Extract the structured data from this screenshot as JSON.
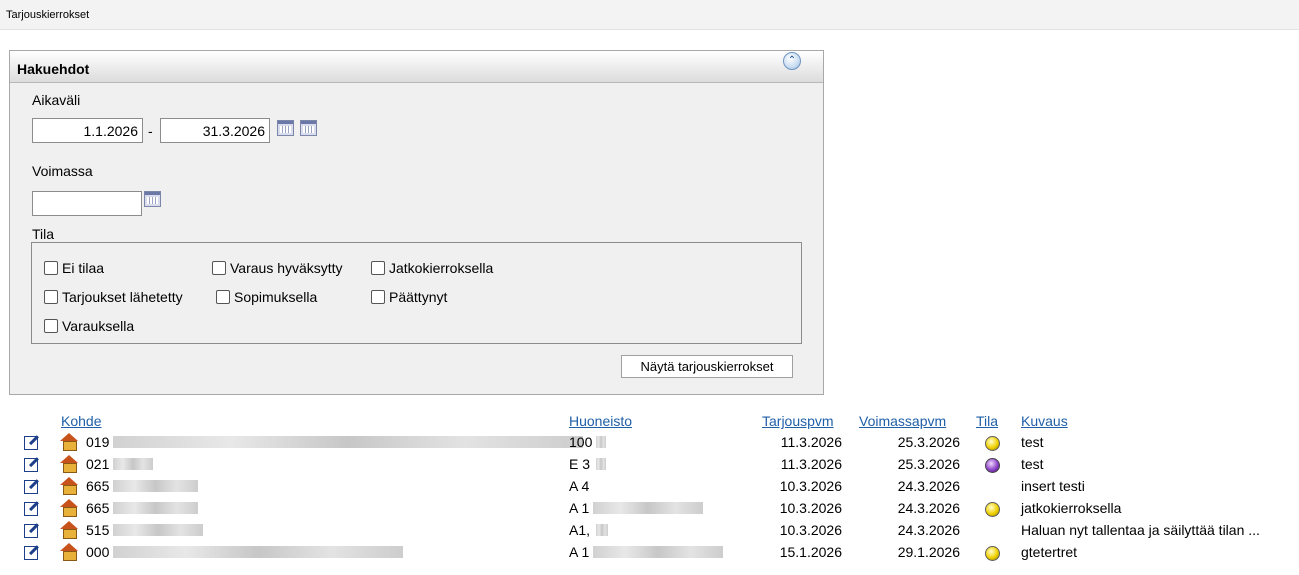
{
  "window": {
    "title": "Tarjouskierrokset"
  },
  "search": {
    "title": "Hakuehdot",
    "period_label": "Aikaväli",
    "date_from": "1.1.2026",
    "separator": "-",
    "date_to": "31.3.2026",
    "valid_label": "Voimassa",
    "valid_value": "",
    "status_label": "Tila",
    "checkboxes": [
      {
        "label": "Ei tilaa",
        "checked": false
      },
      {
        "label": "Varaus hyväksytty",
        "checked": false
      },
      {
        "label": "Jatkokierroksella",
        "checked": false
      },
      {
        "label": "Tarjoukset lähetetty",
        "checked": false
      },
      {
        "label": "Sopimuksella",
        "checked": false
      },
      {
        "label": "Päättynyt",
        "checked": false
      },
      {
        "label": "Varauksella",
        "checked": false
      }
    ],
    "submit_label": "Näytä tarjouskierrokset"
  },
  "table": {
    "headers": {
      "kohde": "Kohde",
      "huoneisto": "Huoneisto",
      "tarjouspvm": "Tarjouspvm",
      "voimassapvm": "Voimassapvm",
      "tila": "Tila",
      "kuvaus": "Kuvaus"
    },
    "rows": [
      {
        "kohde": "019",
        "huoneisto": "100",
        "tarjouspvm": "11.3.2026",
        "voimassapvm": "25.3.2026",
        "tila": "yellow",
        "kuvaus": "test"
      },
      {
        "kohde": "021",
        "huoneisto": "E 3",
        "tarjouspvm": "11.3.2026",
        "voimassapvm": "25.3.2026",
        "tila": "purple",
        "kuvaus": "test"
      },
      {
        "kohde": "665",
        "huoneisto": "A 4",
        "tarjouspvm": "10.3.2026",
        "voimassapvm": "24.3.2026",
        "tila": "",
        "kuvaus": "insert testi"
      },
      {
        "kohde": "665",
        "huoneisto": "A 1",
        "tarjouspvm": "10.3.2026",
        "voimassapvm": "24.3.2026",
        "tila": "yellow",
        "kuvaus": "jatkokierroksella"
      },
      {
        "kohde": "515",
        "huoneisto": "A1,",
        "tarjouspvm": "10.3.2026",
        "voimassapvm": "24.3.2026",
        "tila": "",
        "kuvaus": "Haluan nyt tallentaa ja säilyttää tilan ..."
      },
      {
        "kohde": "000",
        "huoneisto": "A 1",
        "tarjouspvm": "15.1.2026",
        "voimassapvm": "29.1.2026",
        "tila": "yellow",
        "kuvaus": "gtetertret"
      }
    ]
  }
}
